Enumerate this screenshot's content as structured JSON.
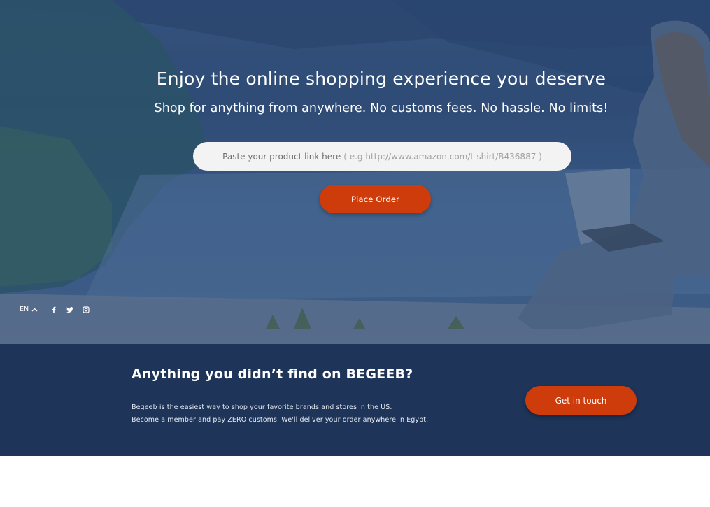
{
  "hero": {
    "title": "Enjoy the online shopping experience you deserve",
    "subtitle": "Shop for anything from anywhere. No customs fees. No hassle. No limits!",
    "input_label": "Paste your product link here",
    "input_hint": "( e.g http://www.amazon.com/t-shirt/B436887 )",
    "button_label": "Place Order"
  },
  "footer_bar": {
    "language": "EN",
    "social": [
      "facebook-icon",
      "twitter-icon",
      "instagram-icon"
    ]
  },
  "banner": {
    "title": "Anything you didn’t find on BEGEEB?",
    "line1": "Begeeb is the easiest way to shop your favorite brands and stores in the US.",
    "line2": "Become a member and pay ZERO customs. We'll deliver your order anywhere in Egypt.",
    "button_label": "Get in touch"
  },
  "colors": {
    "accent": "#cf3c0c",
    "banner_bg": "#1e3458",
    "hero_overlay": "#34517c"
  }
}
